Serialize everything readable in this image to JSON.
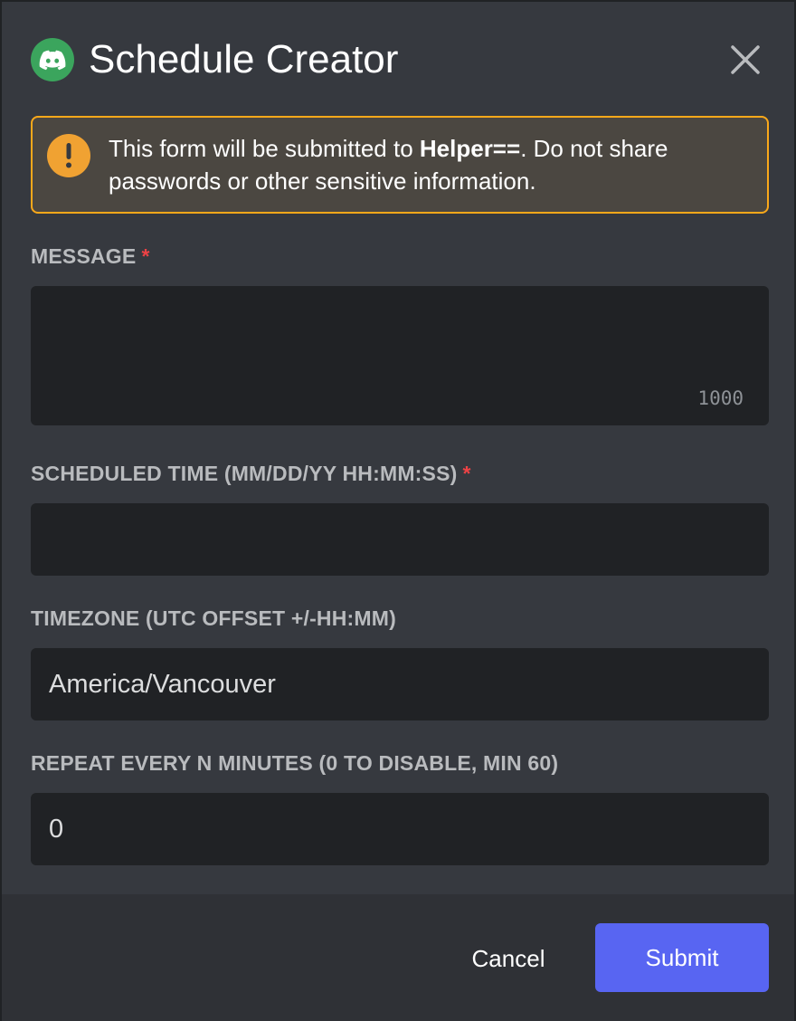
{
  "header": {
    "title": "Schedule Creator",
    "app_icon": "discord-icon",
    "close_icon": "close-icon"
  },
  "notice": {
    "icon": "warning-icon",
    "text_before": "This form will be submitted to ",
    "bot_name": "Helper==",
    "text_after": ". Do not share passwords or other sensitive information."
  },
  "fields": {
    "message": {
      "label": "MESSAGE",
      "required_mark": "*",
      "value": "",
      "char_limit": "1000"
    },
    "scheduled_time": {
      "label": "SCHEDULED TIME (MM/DD/YY HH:MM:SS)",
      "required_mark": "*",
      "value": ""
    },
    "timezone": {
      "label": "TIMEZONE (UTC OFFSET +/-HH:MM)",
      "value": "America/Vancouver"
    },
    "repeat": {
      "label": "REPEAT EVERY N MINUTES (0 TO DISABLE, MIN 60)",
      "value": "0"
    }
  },
  "footer": {
    "cancel_label": "Cancel",
    "submit_label": "Submit"
  },
  "colors": {
    "background": "#36393f",
    "footer": "#2f3136",
    "input": "#202225",
    "warning": "#faa81a",
    "accent": "#5865f2",
    "required": "#ed4245",
    "app_icon": "#3ba55d"
  }
}
